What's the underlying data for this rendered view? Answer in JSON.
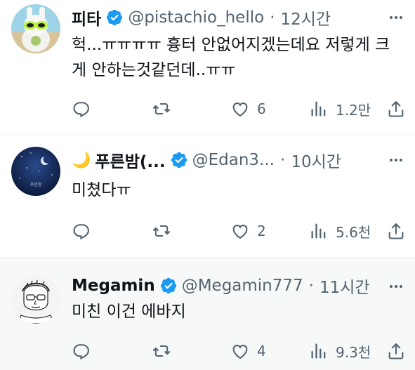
{
  "tweets": [
    {
      "name": "피타",
      "handle": "@pistachio_hello",
      "dot": "·",
      "time": "12시간",
      "text": "헉...ㅠㅠㅠㅠ 흉터 안없어지겠는데요 저렇게 크게 안하는것같던데..ㅠㅠ",
      "likes": "6",
      "views": "1.2만"
    },
    {
      "moon": "🌙",
      "name": "푸른밤(...",
      "handle": "@Edan3...",
      "dot": "·",
      "time": "10시간",
      "text": "미쳤다ㅠ",
      "likes": "2",
      "views": "5.6천",
      "avatar_caption": "푸른밤"
    },
    {
      "name": "Megamin",
      "handle": "@Megamin777",
      "dot": "·",
      "time": "11시간",
      "text": "미친 이건 에바지",
      "likes": "4",
      "views": "9.3천"
    }
  ],
  "colors": {
    "verified": "#1d9bf0",
    "secondary_text": "#536471",
    "primary_text": "#0f1419",
    "hover_background": "#f7f9f9"
  },
  "icons": [
    "verified-badge-icon",
    "more-icon",
    "reply-icon",
    "retweet-icon",
    "like-icon",
    "views-icon",
    "share-icon"
  ]
}
